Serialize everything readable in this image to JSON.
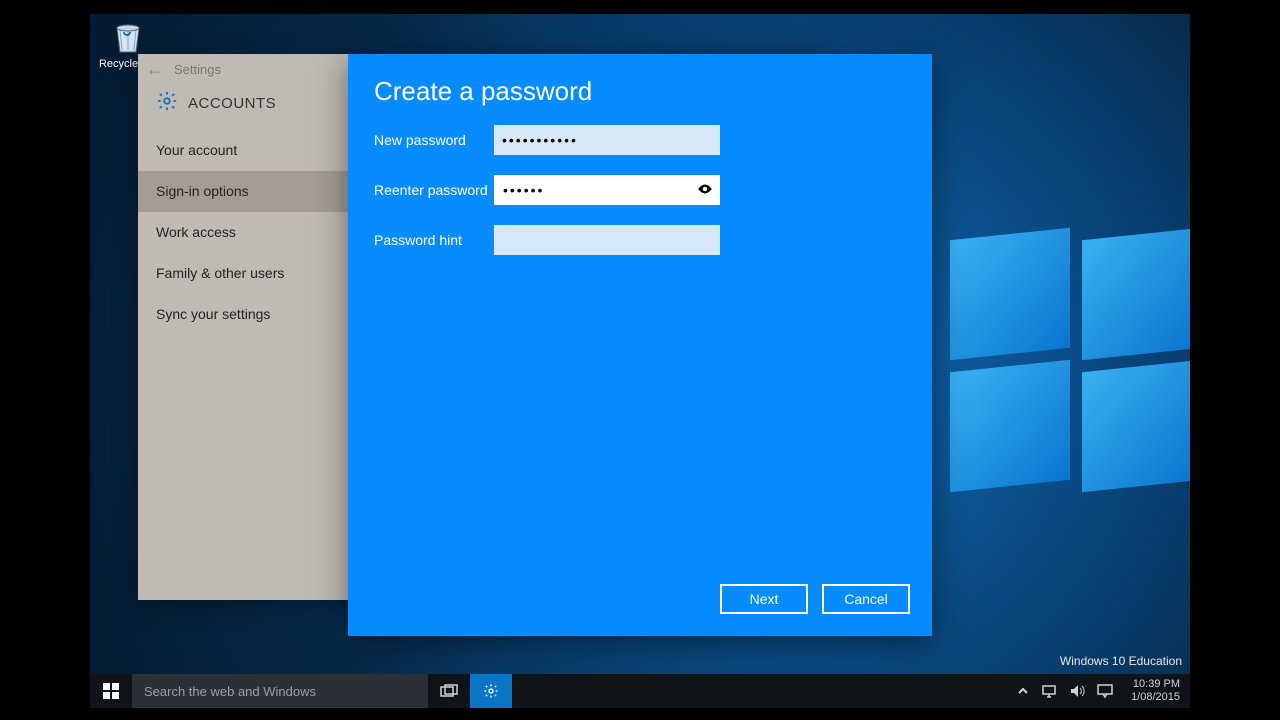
{
  "desktop": {
    "recycle_label": "Recycle Bin",
    "watermark": "Windows 10 Education"
  },
  "settings": {
    "window_title": "Settings",
    "section": "ACCOUNTS",
    "items": [
      "Your account",
      "Sign-in options",
      "Work access",
      "Family & other users",
      "Sync your settings"
    ]
  },
  "dialog": {
    "title": "Create a password",
    "labels": {
      "new": "New password",
      "reenter": "Reenter password",
      "hint": "Password hint"
    },
    "values": {
      "new": "•••••••••••",
      "reenter": "••••••",
      "hint": ""
    },
    "buttons": {
      "next": "Next",
      "cancel": "Cancel"
    }
  },
  "taskbar": {
    "search_placeholder": "Search the web and Windows",
    "time": "10:39 PM",
    "date": "1/08/2015"
  }
}
